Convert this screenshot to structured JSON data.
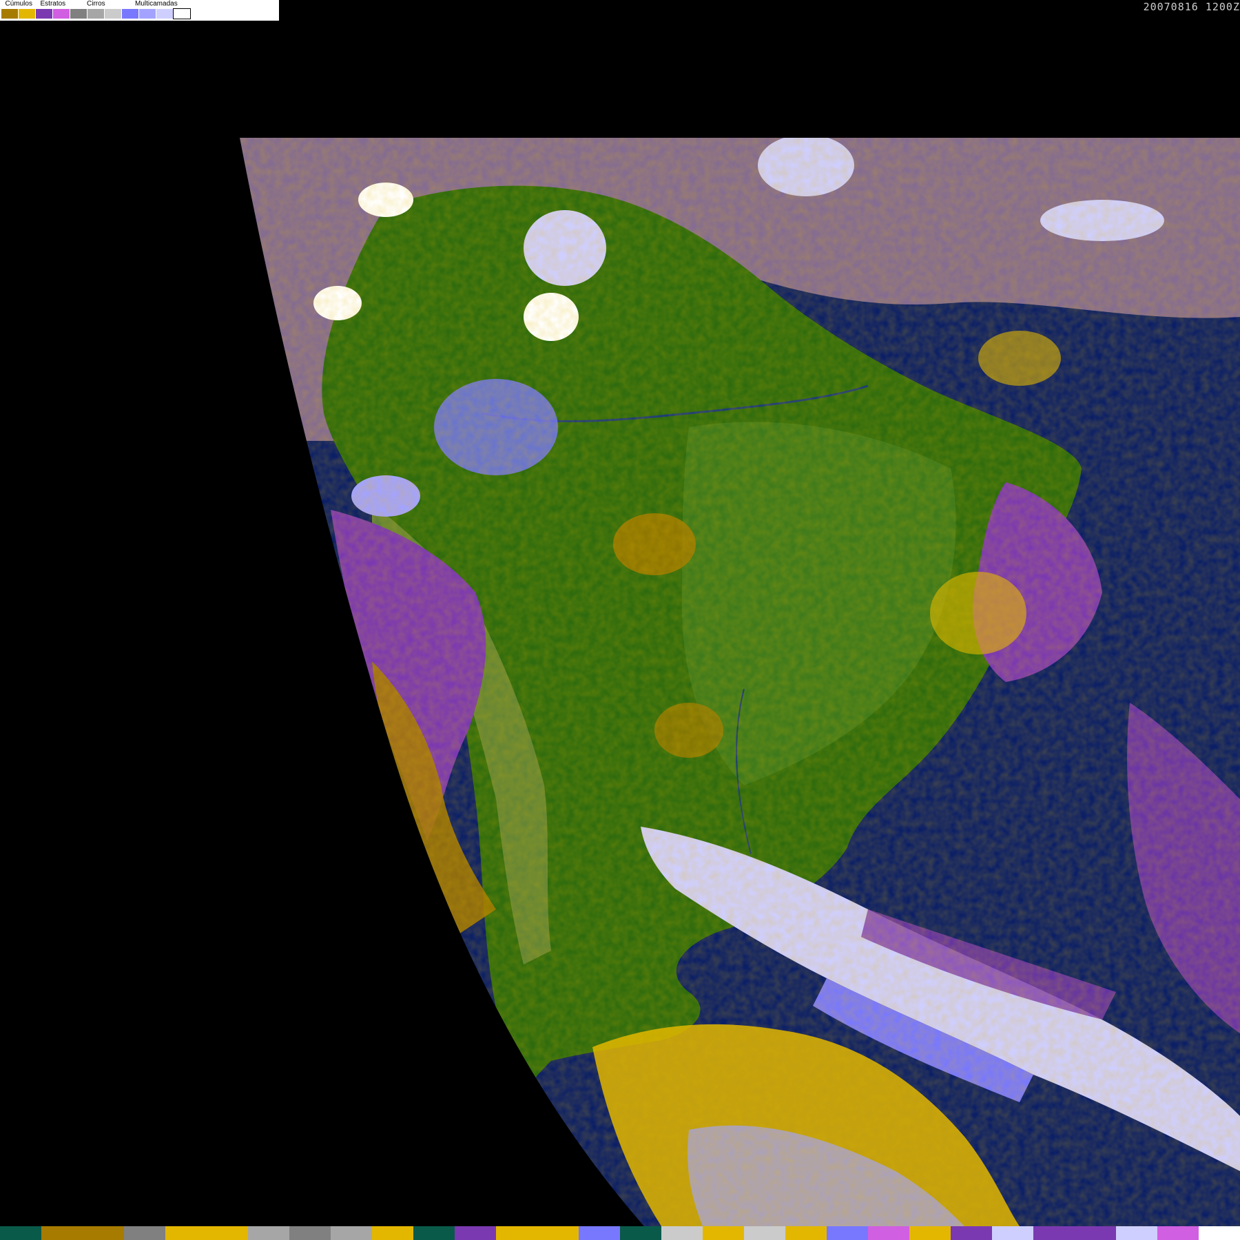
{
  "legend": {
    "groups": [
      {
        "label": "Cúmulos",
        "colors": [
          "#a77b00",
          "#e3b700"
        ]
      },
      {
        "label": "Estratos",
        "colors": [
          "#7b39b1",
          "#d15fe1"
        ]
      },
      {
        "label": "Cirros",
        "colors": [
          "#808080",
          "#a6a6a6",
          "#cbcbcb"
        ]
      },
      {
        "label": "Multicamadas",
        "colors": [
          "#7878ff",
          "#a3a3ff",
          "#cfcfff",
          "#ffffff"
        ]
      }
    ]
  },
  "timestamp": "20070816 1200Z",
  "map_colors": {
    "space": "#000000",
    "ocean": "#0b1f67",
    "vegetation": "#2e6b0e",
    "vegetation_dark": "#1f5a06",
    "terrain": "#6b8a3a",
    "stratus": "#7b39b1",
    "stratus_light": "#d15fe1",
    "cumulus": "#e3b700",
    "cumulus_dark": "#a77b00",
    "cirrus": "#a6a6a6",
    "multilayer": "#7878ff",
    "multilayer_light": "#cfcfff",
    "white": "#ffffff"
  },
  "bottom_bar": [
    "#0a5a4a",
    "#a77b00",
    "#a77b00",
    "#808080",
    "#e3b700",
    "#e3b700",
    "#a6a6a6",
    "#808080",
    "#a6a6a6",
    "#e3b700",
    "#0a5a4a",
    "#7b39b1",
    "#e3b700",
    "#e3b700",
    "#7878ff",
    "#0a5a4a",
    "#cbcbcb",
    "#e3b700",
    "#cbcbcb",
    "#e3b700",
    "#7878ff",
    "#d15fe1",
    "#e3b700",
    "#7b39b1",
    "#cfcfff",
    "#7b39b1",
    "#7b39b1",
    "#cfcfff",
    "#d15fe1",
    "#ffffff"
  ]
}
